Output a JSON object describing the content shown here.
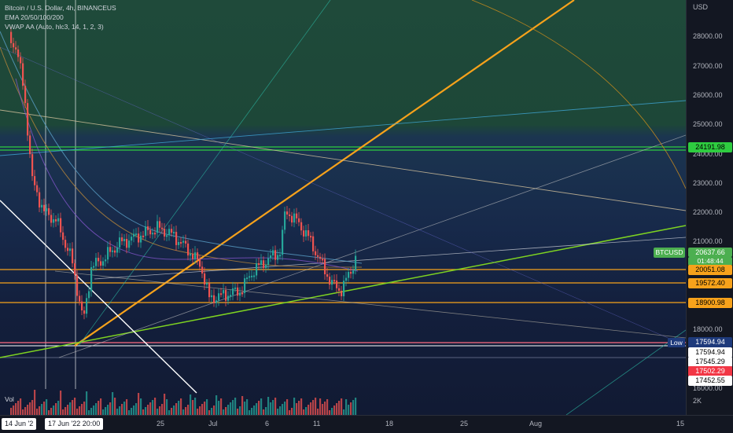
{
  "header": {
    "title": "Bitcoin / U.S. Dollar, 4h, BINANCEUS",
    "indicator_ema": "EMA 20/50/100/200",
    "indicator_vwap": "VWAP AA (Auto, hlc3, 14, 1, 2, 3)"
  },
  "volume_label": "Vol",
  "currency_label": "USD",
  "price_scale": {
    "ticks": [
      "28000.00",
      "27000.00",
      "26000.00",
      "25000.00",
      "24000.00",
      "23000.00",
      "22000.00",
      "21000.00",
      "18000.00",
      "16000.00"
    ],
    "volume_tick": "2K"
  },
  "price_labels": {
    "level_24191": "24191.98",
    "btcusd_name": "BTCUSD",
    "btcusd_price": "20637.66",
    "btcusd_timer": "01:48:44",
    "level_20051": "20051.08",
    "level_19572": "19572.40",
    "level_18900": "18900.98",
    "low_tag": "Low",
    "low_value": "17594.94",
    "value_17594": "17594.94",
    "value_17545": "17545.29",
    "value_17502": "17502.29",
    "value_17452": "17452.55"
  },
  "time_axis": {
    "badge_left": "14 Jun '2",
    "badge_right": "17 Jun '22   20:00",
    "labels": [
      "25",
      "Jul",
      "6",
      "11",
      "18",
      "25",
      "Aug",
      "15"
    ]
  },
  "colors": {
    "up": "#26a69a",
    "down": "#ef5350",
    "orange": "#f7a21b",
    "green": "#7ed321",
    "btc_label": "#4caf50"
  }
}
